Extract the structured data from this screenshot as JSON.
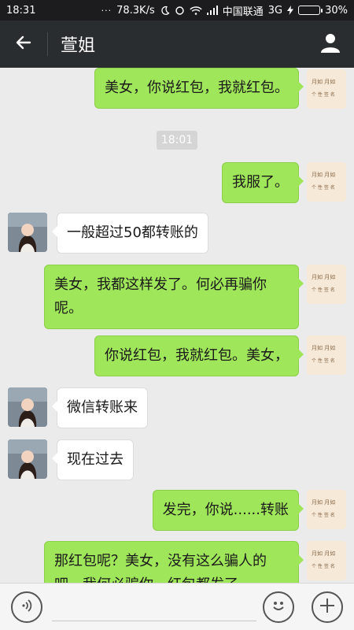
{
  "status_bar": {
    "time": "18:31",
    "dots": "···",
    "speed": "78.3K/s",
    "carrier": "中国联通",
    "network": "3G",
    "battery": "30%",
    "battery_level": 0.3
  },
  "header": {
    "title": "萱姐"
  },
  "timestamp": "18:01",
  "messages": [
    {
      "side": "self",
      "text": "美女，你说红包，我就红包。"
    },
    {
      "side": "self",
      "text": "我服了。"
    },
    {
      "side": "other",
      "text": "一般超过50都转账的"
    },
    {
      "side": "self",
      "text": "美女，我都这样发了。何必再骗你呢。"
    },
    {
      "side": "self",
      "text": "你说红包，我就红包。美女，"
    },
    {
      "side": "other",
      "text": "微信转账来"
    },
    {
      "side": "other",
      "text": "现在过去"
    },
    {
      "side": "self",
      "text": "发完，你说......转账"
    },
    {
      "side": "self",
      "text": "那红包呢？美女，没有这么骗人的吧，我何必骗你，红包都发了"
    }
  ],
  "input": {
    "value": ""
  },
  "colors": {
    "header_bg": "#2a2d2f",
    "chat_bg": "#ebebeb",
    "self_bubble": "#9fe65a",
    "other_bubble": "#ffffff"
  },
  "icons": {
    "back": "back-arrow-icon",
    "profile": "person-icon",
    "voice": "voice-icon",
    "emoji": "smiley-icon",
    "plus": "plus-icon"
  }
}
